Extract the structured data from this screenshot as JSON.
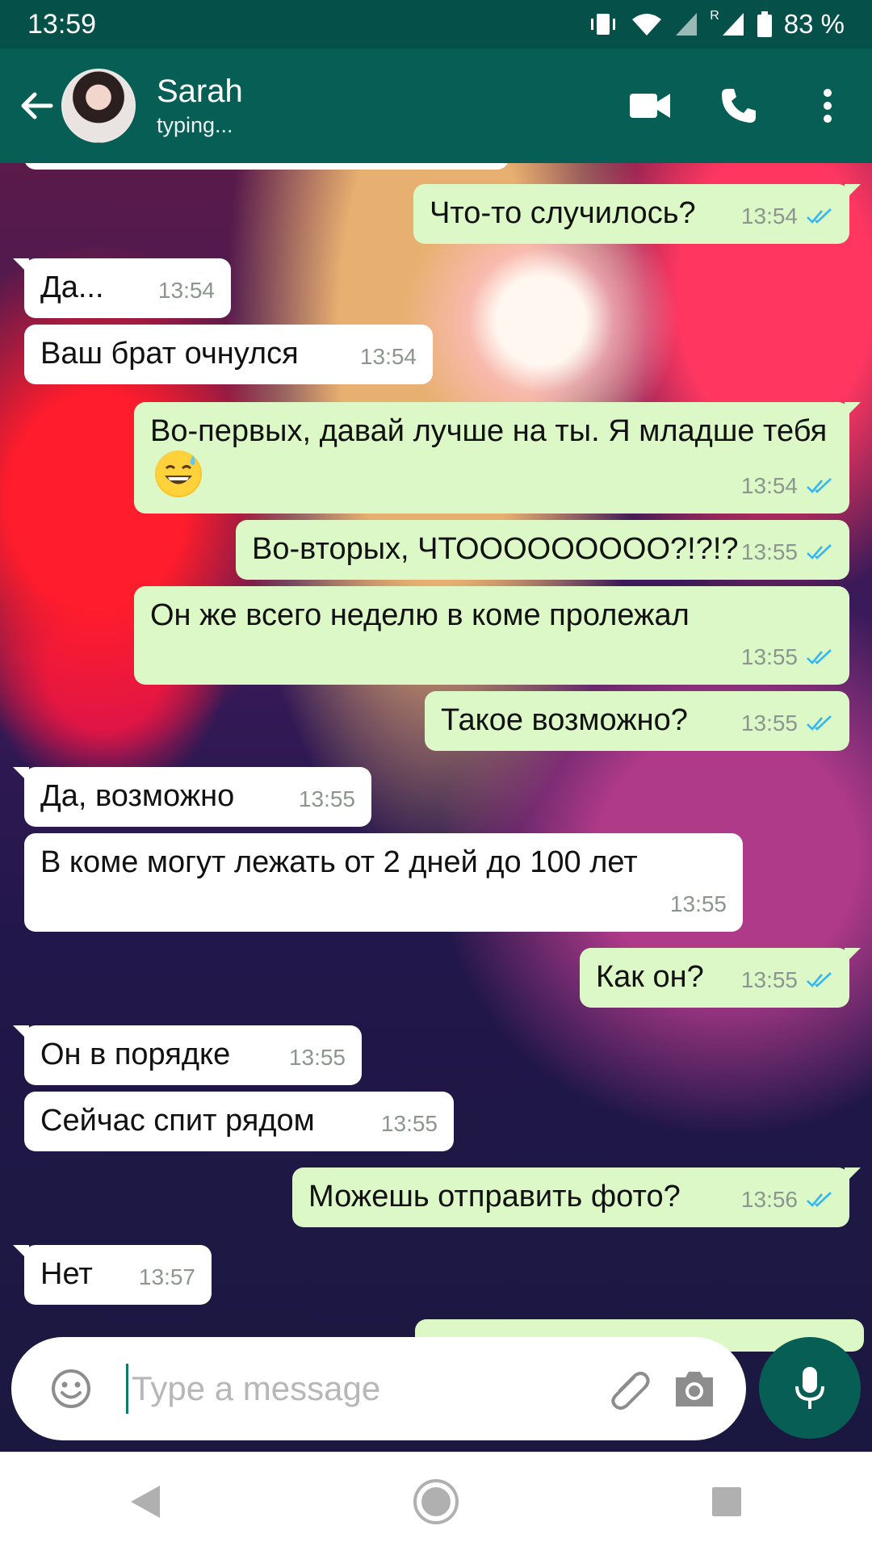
{
  "status_bar": {
    "time": "13:59",
    "battery": "83 %",
    "roaming": "R"
  },
  "header": {
    "contact_name": "Sarah",
    "status": "typing..."
  },
  "messages": [
    {
      "dir": "out",
      "text": "Что-то случилось?",
      "time": "13:54",
      "read": true
    },
    {
      "dir": "in",
      "text": "Да...",
      "time": "13:54"
    },
    {
      "dir": "in",
      "text": "Ваш брат очнулся",
      "time": "13:54"
    },
    {
      "dir": "out",
      "text": "Во-первых, давай лучше на ты. Я младше тебя",
      "emoji": "grinning-sweat-emoji",
      "time": "13:54",
      "read": true
    },
    {
      "dir": "out",
      "text": "Во-вторых, ЧТООООООООО?!?!?",
      "time": "13:55",
      "read": true
    },
    {
      "dir": "out",
      "text": "Он же всего неделю в коме пролежал",
      "time": "13:55",
      "read": true
    },
    {
      "dir": "out",
      "text": "Такое возможно?",
      "time": "13:55",
      "read": true
    },
    {
      "dir": "in",
      "text": "Да, возможно",
      "time": "13:55"
    },
    {
      "dir": "in",
      "text": "В коме могут лежать от 2 дней до 100 лет",
      "time": "13:55"
    },
    {
      "dir": "out",
      "text": "Как он?",
      "time": "13:55",
      "read": true
    },
    {
      "dir": "in",
      "text": "Он в порядке",
      "time": "13:55"
    },
    {
      "dir": "in",
      "text": "Сейчас спит рядом",
      "time": "13:55"
    },
    {
      "dir": "out",
      "text": "Можешь отправить фото?",
      "time": "13:56",
      "read": true
    },
    {
      "dir": "in",
      "text": "Нет",
      "time": "13:57"
    }
  ],
  "composer": {
    "placeholder": "Type a message",
    "value": ""
  },
  "colors": {
    "header": "#075e54",
    "status_bar": "#06504a",
    "outgoing": "#dcf8c6",
    "incoming": "#ffffff",
    "read_ticks": "#34b7f1"
  },
  "icons": {
    "back": "arrow-left-icon",
    "video": "video-call-icon",
    "call": "phone-icon",
    "menu": "more-vert-icon",
    "emoji": "emoji-icon",
    "attach": "paperclip-icon",
    "camera": "camera-icon",
    "mic": "mic-icon",
    "nav_back": "nav-back-icon",
    "nav_home": "nav-home-icon",
    "nav_recents": "nav-recents-icon"
  }
}
